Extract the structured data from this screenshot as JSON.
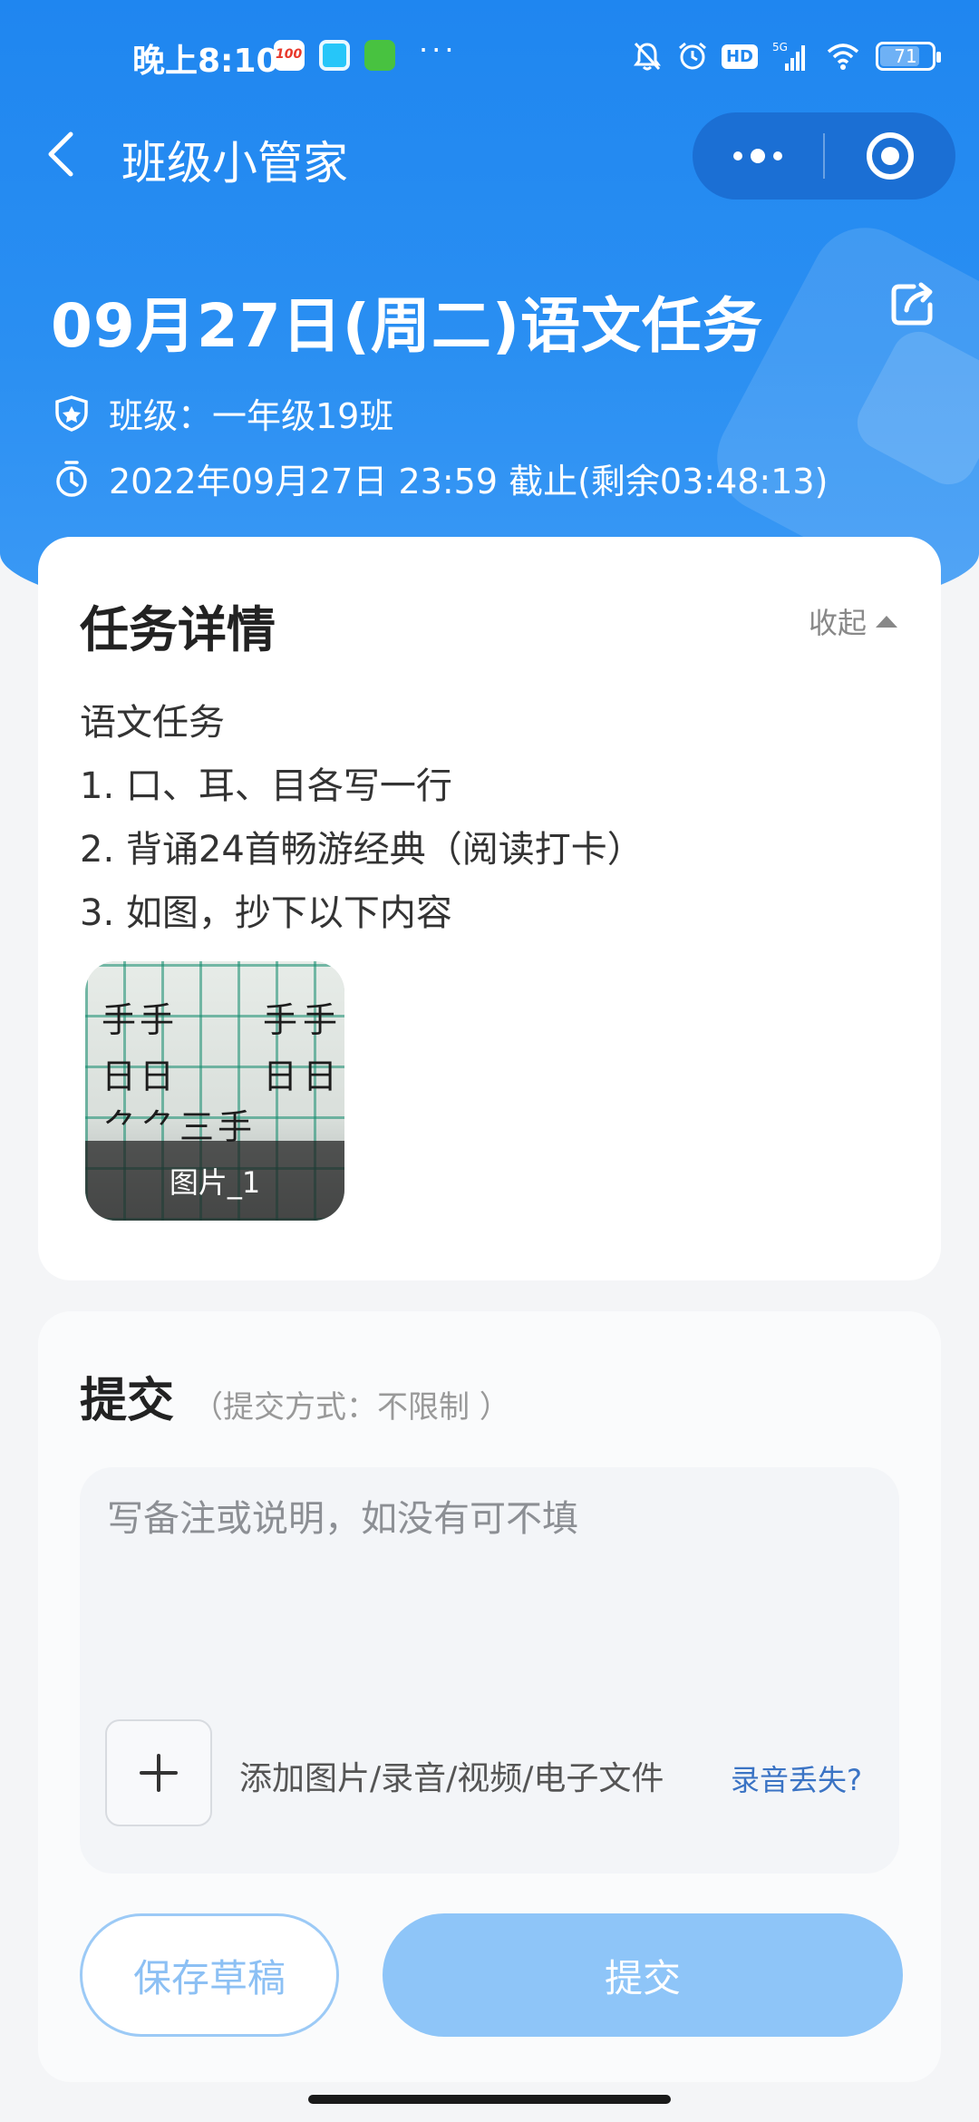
{
  "status_bar": {
    "time": "晚上8:10",
    "dots": "···",
    "hd_label": "HD",
    "network": "5G",
    "battery": "71"
  },
  "nav": {
    "title": "班级小管家"
  },
  "task": {
    "title": "09月27日(周二)语文任务",
    "class_label": "班级：一年级19班",
    "deadline": "2022年09月27日 23:59 截止(剩余03:48:13)"
  },
  "detail": {
    "heading": "任务详情",
    "collapse_label": "收起",
    "lines": [
      "语文任务",
      "1. 口、耳、目各写一行",
      "2. 背诵24首畅游经典（阅读打卡）",
      "3. 如图，抄下以下内容"
    ],
    "image_caption": "图片_1"
  },
  "submit": {
    "heading": "提交",
    "mode": "（提交方式：不限制 ）",
    "note_placeholder": "写备注或说明，如没有可不填",
    "add_label": "添加图片/录音/视频/电子文件",
    "lost_link": "录音丢失?",
    "draft_button": "保存草稿",
    "submit_button": "提交"
  },
  "colors": {
    "primary": "#1f86f0",
    "submit_disabled": "#8ec5f8",
    "link": "#3a73c4"
  }
}
